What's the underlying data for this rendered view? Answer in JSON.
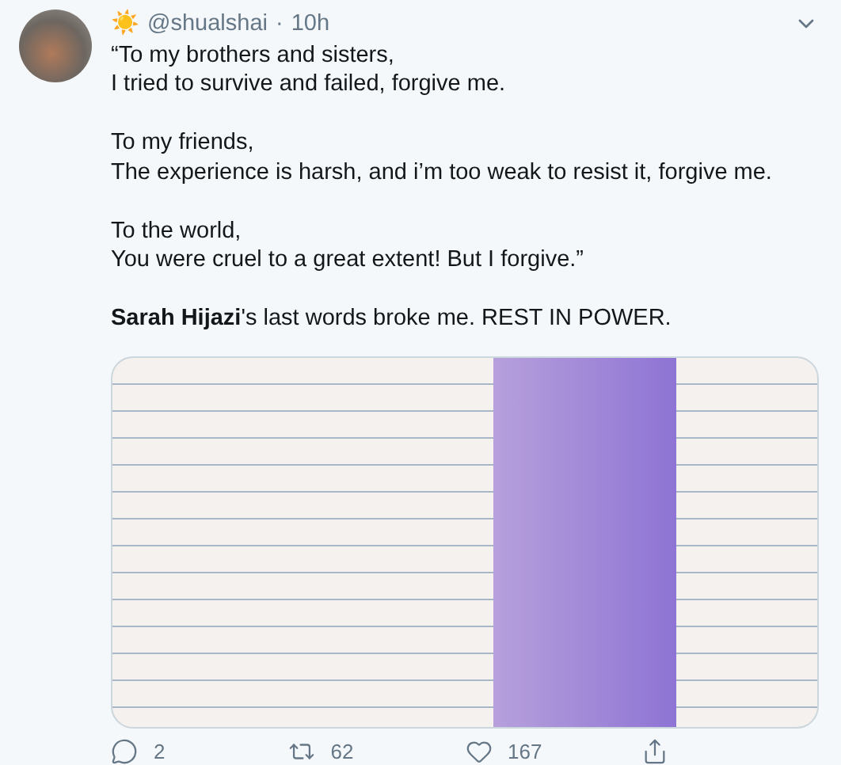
{
  "tweet": {
    "display_name": "☀️",
    "handle": "@shualshai",
    "separator": "·",
    "time": "10h",
    "paragraphs": [
      [
        "“To my brothers and sisters,",
        "I tried to survive and failed, forgive me."
      ],
      [
        "To my friends,",
        "The experience is harsh, and i’m too weak to resist it, forgive me."
      ],
      [
        "To the world,",
        "You were cruel to a great extent! But I forgive.”"
      ],
      [
        "**Sarah Hijazi**'s last words broke me. REST IN POWER."
      ]
    ],
    "actions": [
      {
        "kind": "reply",
        "count": "2"
      },
      {
        "kind": "retweet",
        "count": "62"
      },
      {
        "kind": "like",
        "count": "167"
      },
      {
        "kind": "share"
      }
    ]
  }
}
